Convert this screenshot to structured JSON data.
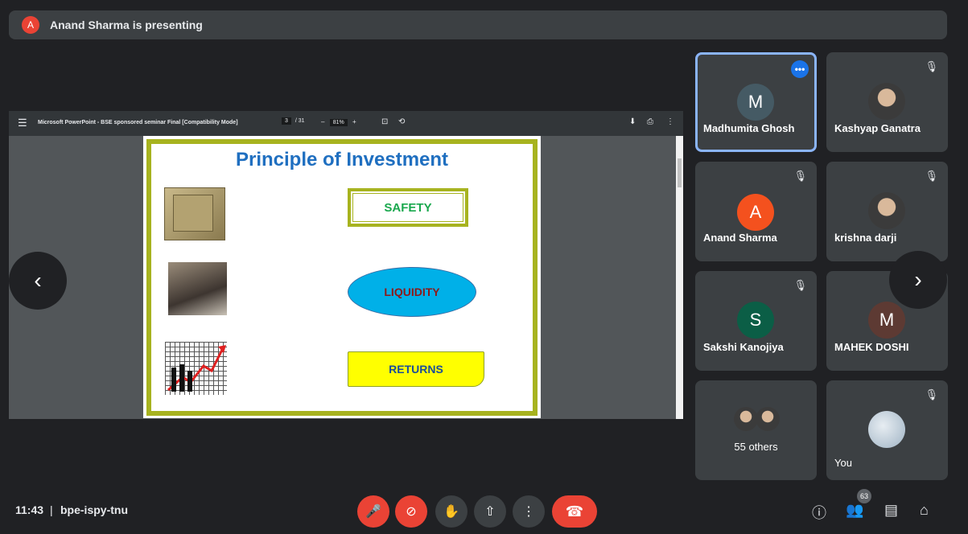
{
  "presenter_bar": {
    "avatar_letter": "A",
    "text": "Anand Sharma is presenting"
  },
  "viewer": {
    "menu_icon": "☰",
    "title": "Microsoft PowerPoint - BSE sponsored seminar Final [Compatibility Mode]",
    "page_current": "3",
    "page_total": "/ 31",
    "zoom_minus": "–",
    "zoom_value": "81%",
    "zoom_plus": "+",
    "fit_icon": "⊡",
    "rotate_icon": "⟲",
    "download_icon": "⬇",
    "print_icon": "⎙",
    "more_icon": "⋮"
  },
  "slide": {
    "title": "Principle of Investment",
    "items": [
      "SAFETY",
      "LIQUIDITY",
      "RETURNS"
    ]
  },
  "nav": {
    "prev": "‹",
    "next": "›"
  },
  "participants": [
    {
      "name": "Madhumita Ghosh",
      "initial": "M",
      "color": "#455a64",
      "more": "•••"
    },
    {
      "name": "Kashyap Ganatra",
      "mic": "🎙"
    },
    {
      "name": "Anand Sharma",
      "initial": "A",
      "color": "#f4511e",
      "mic": "🎙"
    },
    {
      "name": "krishna darji",
      "mic": "🎙"
    },
    {
      "name": "Sakshi Kanojiya",
      "initial": "S",
      "color": "#0b5e46",
      "mic": "🎙"
    },
    {
      "name": "MAHEK DOSHI",
      "initial": "M",
      "color": "#5d3a33"
    },
    {
      "name": "55 others"
    },
    {
      "name": "You",
      "mic": "🎙"
    }
  ],
  "bottom": {
    "time": "11:43",
    "separator": "|",
    "meeting_code": "bpe-ispy-tnu",
    "mic_icon": "🎤",
    "cam_icon": "⊘",
    "hand_icon": "✋",
    "present_icon": "⇧",
    "more_icon": "⋮",
    "end_icon": "☎",
    "info_icon": "ⓘ",
    "people_icon": "👥",
    "people_count": "63",
    "chat_icon": "▤",
    "activities_icon": "⌂"
  }
}
